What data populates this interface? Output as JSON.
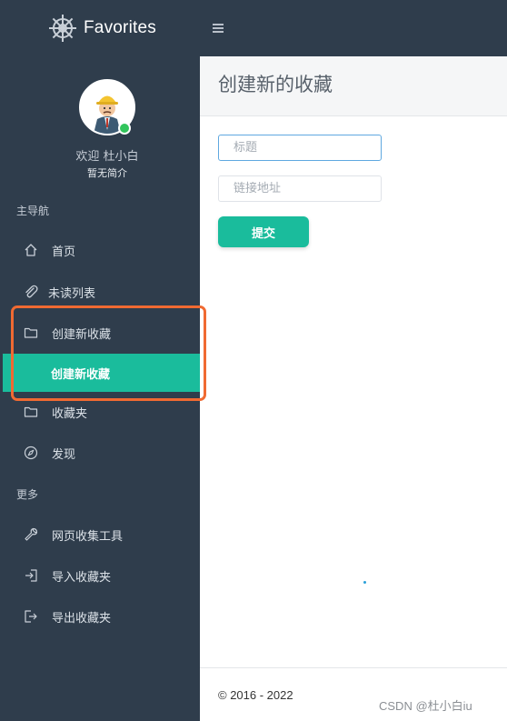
{
  "header": {
    "brand": "Favorites"
  },
  "user": {
    "welcome": "欢迎 杜小白",
    "intro": "暂无简介"
  },
  "nav": {
    "section_main": "主导航",
    "home": "首页",
    "unread": "未读列表",
    "create_group": "创建新收藏",
    "create_sub": "创建新收藏",
    "favorites": "收藏夹",
    "discover": "发现",
    "section_more": "更多",
    "web_tool": "网页收集工具",
    "import": "导入收藏夹",
    "export": "导出收藏夹"
  },
  "main": {
    "title": "创建新的收藏",
    "title_placeholder": "标题",
    "url_placeholder": "链接地址",
    "submit_label": "提交"
  },
  "footer": {
    "copyright": "© 2016 - 2022"
  },
  "watermark": "CSDN @杜小白iu",
  "colors": {
    "sidebar": "#2f3d4c",
    "accent": "#1abc9c",
    "annotation": "#f06a32",
    "online": "#32c55c"
  },
  "icons": {
    "home": "home-icon",
    "unread": "paperclip-icon",
    "create": "folder-icon",
    "favorites": "folder-icon",
    "discover": "compass-icon",
    "web_tool": "wrench-icon",
    "import": "import-icon",
    "export": "export-icon"
  }
}
